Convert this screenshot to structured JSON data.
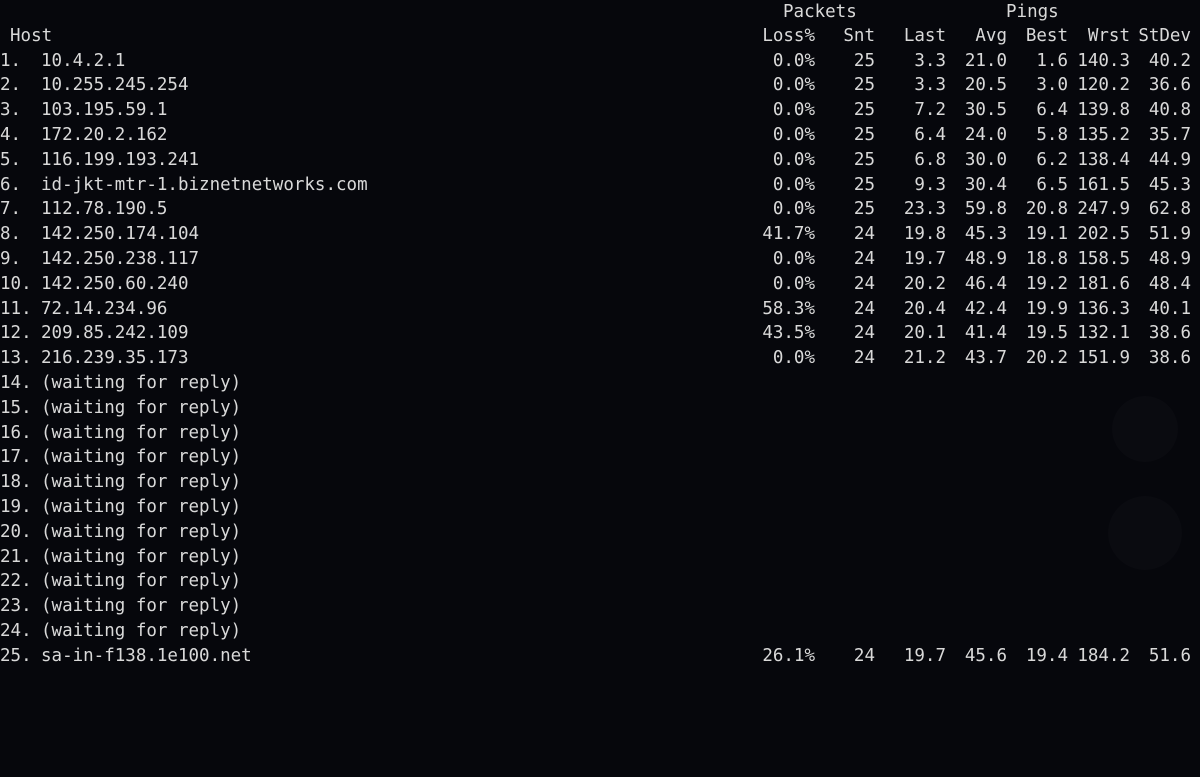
{
  "header": {
    "group_packets": "Packets",
    "group_pings": "Pings",
    "host": "Host",
    "loss": "Loss%",
    "snt": "Snt",
    "last": "Last",
    "avg": "Avg",
    "best": "Best",
    "wrst": "Wrst",
    "stdev": "StDev"
  },
  "rows": [
    {
      "num": "1.",
      "host": "10.4.2.1",
      "loss": "0.0%",
      "snt": "25",
      "last": "3.3",
      "avg": "21.0",
      "best": "1.6",
      "wrst": "140.3",
      "stdev": "40.2"
    },
    {
      "num": "2.",
      "host": "10.255.245.254",
      "loss": "0.0%",
      "snt": "25",
      "last": "3.3",
      "avg": "20.5",
      "best": "3.0",
      "wrst": "120.2",
      "stdev": "36.6"
    },
    {
      "num": "3.",
      "host": "103.195.59.1",
      "loss": "0.0%",
      "snt": "25",
      "last": "7.2",
      "avg": "30.5",
      "best": "6.4",
      "wrst": "139.8",
      "stdev": "40.8"
    },
    {
      "num": "4.",
      "host": "172.20.2.162",
      "loss": "0.0%",
      "snt": "25",
      "last": "6.4",
      "avg": "24.0",
      "best": "5.8",
      "wrst": "135.2",
      "stdev": "35.7"
    },
    {
      "num": "5.",
      "host": "116.199.193.241",
      "loss": "0.0%",
      "snt": "25",
      "last": "6.8",
      "avg": "30.0",
      "best": "6.2",
      "wrst": "138.4",
      "stdev": "44.9"
    },
    {
      "num": "6.",
      "host": "id-jkt-mtr-1.biznetnetworks.com",
      "loss": "0.0%",
      "snt": "25",
      "last": "9.3",
      "avg": "30.4",
      "best": "6.5",
      "wrst": "161.5",
      "stdev": "45.3"
    },
    {
      "num": "7.",
      "host": "112.78.190.5",
      "loss": "0.0%",
      "snt": "25",
      "last": "23.3",
      "avg": "59.8",
      "best": "20.8",
      "wrst": "247.9",
      "stdev": "62.8"
    },
    {
      "num": "8.",
      "host": "142.250.174.104",
      "loss": "41.7%",
      "snt": "24",
      "last": "19.8",
      "avg": "45.3",
      "best": "19.1",
      "wrst": "202.5",
      "stdev": "51.9"
    },
    {
      "num": "9.",
      "host": "142.250.238.117",
      "loss": "0.0%",
      "snt": "24",
      "last": "19.7",
      "avg": "48.9",
      "best": "18.8",
      "wrst": "158.5",
      "stdev": "48.9"
    },
    {
      "num": "10.",
      "host": "142.250.60.240",
      "loss": "0.0%",
      "snt": "24",
      "last": "20.2",
      "avg": "46.4",
      "best": "19.2",
      "wrst": "181.6",
      "stdev": "48.4"
    },
    {
      "num": "11.",
      "host": "72.14.234.96",
      "loss": "58.3%",
      "snt": "24",
      "last": "20.4",
      "avg": "42.4",
      "best": "19.9",
      "wrst": "136.3",
      "stdev": "40.1"
    },
    {
      "num": "12.",
      "host": "209.85.242.109",
      "loss": "43.5%",
      "snt": "24",
      "last": "20.1",
      "avg": "41.4",
      "best": "19.5",
      "wrst": "132.1",
      "stdev": "38.6"
    },
    {
      "num": "13.",
      "host": "216.239.35.173",
      "loss": "0.0%",
      "snt": "24",
      "last": "21.2",
      "avg": "43.7",
      "best": "20.2",
      "wrst": "151.9",
      "stdev": "38.6"
    },
    {
      "num": "14.",
      "host": "(waiting for reply)"
    },
    {
      "num": "15.",
      "host": "(waiting for reply)"
    },
    {
      "num": "16.",
      "host": "(waiting for reply)"
    },
    {
      "num": "17.",
      "host": "(waiting for reply)"
    },
    {
      "num": "18.",
      "host": "(waiting for reply)"
    },
    {
      "num": "19.",
      "host": "(waiting for reply)"
    },
    {
      "num": "20.",
      "host": "(waiting for reply)"
    },
    {
      "num": "21.",
      "host": "(waiting for reply)"
    },
    {
      "num": "22.",
      "host": "(waiting for reply)"
    },
    {
      "num": "23.",
      "host": "(waiting for reply)"
    },
    {
      "num": "24.",
      "host": "(waiting for reply)"
    },
    {
      "num": "25.",
      "host": "sa-in-f138.1e100.net",
      "loss": "26.1%",
      "snt": "24",
      "last": "19.7",
      "avg": "45.6",
      "best": "19.4",
      "wrst": "184.2",
      "stdev": "51.6"
    }
  ]
}
